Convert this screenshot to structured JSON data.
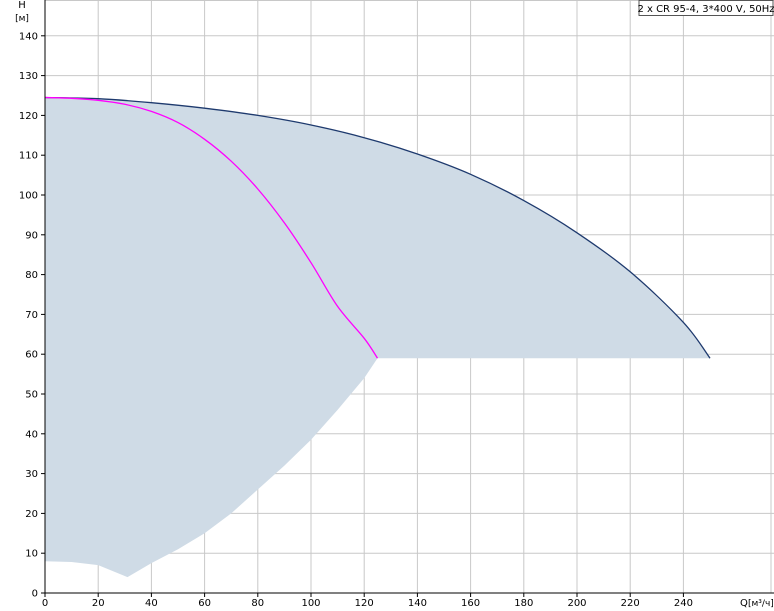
{
  "chart_data": {
    "type": "line",
    "y_axis": {
      "symbol": "H",
      "unit": "[м]",
      "min": 0,
      "max": 150,
      "ticks": [
        0,
        10,
        20,
        30,
        40,
        50,
        60,
        70,
        80,
        90,
        100,
        110,
        120,
        130,
        140
      ]
    },
    "x_axis": {
      "symbol": "Q",
      "unit": "[м³/ч]",
      "min": 0,
      "max": 260,
      "ticks": [
        0,
        20,
        40,
        60,
        80,
        100,
        120,
        140,
        160,
        180,
        200,
        220,
        240
      ]
    },
    "legend": "2 x CR 95-4, 3*400 V, 50Hz",
    "legend_position": "top-right",
    "grid": true,
    "colors": {
      "dark_curve": "#1e3a6e",
      "magenta_curve": "#ff00ff",
      "area_fill": "#cfdbe6",
      "grid": "#c8c8c8"
    },
    "series": [
      {
        "kind": "pump-curve-2-pumps",
        "x": [
          0,
          20,
          40,
          60,
          80,
          100,
          120,
          140,
          160,
          180,
          200,
          220,
          240,
          250
        ],
        "y": [
          124.5,
          124.2,
          123.2,
          121.8,
          120.0,
          117.6,
          114.4,
          110.3,
          105.2,
          98.6,
          90.5,
          80.7,
          68.0,
          59.0
        ]
      },
      {
        "kind": "pump-curve-1-pump",
        "x": [
          0,
          10,
          20,
          30,
          40,
          50,
          60,
          70,
          80,
          90,
          100,
          110,
          120,
          125
        ],
        "y": [
          124.5,
          124.3,
          123.8,
          122.8,
          121.0,
          118.2,
          114.0,
          108.5,
          101.5,
          93.0,
          83.0,
          72.0,
          64.0,
          59.0
        ]
      }
    ],
    "operating_range_area": {
      "upper_x": [
        0,
        20,
        40,
        60,
        80,
        100,
        120,
        140,
        160,
        180,
        200,
        220,
        240,
        250
      ],
      "upper_y": [
        124.5,
        124.2,
        123.2,
        121.8,
        120.0,
        117.6,
        114.4,
        110.3,
        105.2,
        98.6,
        90.5,
        80.7,
        68.0,
        59.0
      ],
      "lower_x": [
        250,
        125,
        120,
        110,
        100,
        90,
        80,
        70,
        60,
        50,
        40,
        31,
        20,
        10,
        0
      ],
      "lower_y": [
        59.0,
        59.0,
        54.0,
        46.0,
        38.5,
        32.0,
        26.0,
        20.0,
        15.0,
        11.0,
        7.5,
        4.0,
        7.0,
        7.8,
        8.0
      ]
    }
  }
}
